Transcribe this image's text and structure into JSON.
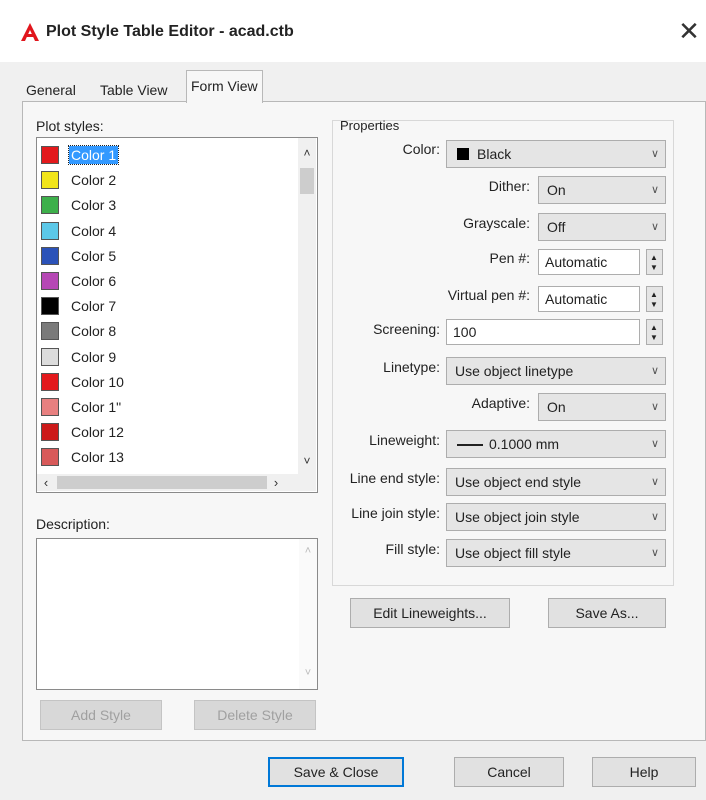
{
  "window": {
    "title": "Plot Style Table Editor - acad.ctb",
    "logo_letter": "A",
    "logo_color": "#e1161d",
    "close_glyph": "✕"
  },
  "tabs": [
    {
      "label": "General"
    },
    {
      "label": "Table View"
    },
    {
      "label": "Form View",
      "active": true
    }
  ],
  "plot_styles": {
    "label": "Plot styles:",
    "selected": "Color 1",
    "items": [
      {
        "label": "Color 1",
        "color": "#e3191c"
      },
      {
        "label": "Color 2",
        "color": "#f2e51a"
      },
      {
        "label": "Color 3",
        "color": "#3db04b"
      },
      {
        "label": "Color 4",
        "color": "#5cc8e8"
      },
      {
        "label": "Color 5",
        "color": "#2b52b8"
      },
      {
        "label": "Color 6",
        "color": "#b648b5"
      },
      {
        "label": "Color 7",
        "color": "#000000"
      },
      {
        "label": "Color 8",
        "color": "#7a7a7a"
      },
      {
        "label": "Color 9",
        "color": "#dcdcdc"
      },
      {
        "label": "Color 10",
        "color": "#e3191c"
      },
      {
        "label": "Color 1\"",
        "color": "#e88080"
      },
      {
        "label": "Color 12",
        "color": "#cc1a1a"
      },
      {
        "label": "Color 13",
        "color": "#d85a5a"
      }
    ]
  },
  "description": {
    "label": "Description:",
    "value": ""
  },
  "buttons_left": {
    "add_style": "Add Style",
    "delete_style": "Delete Style"
  },
  "properties": {
    "heading": "Properties",
    "color_label": "Color:",
    "color_value": "Black",
    "color_swatch": "#000000",
    "dither_label": "Dither:",
    "dither_value": "On",
    "grayscale_label": "Grayscale:",
    "grayscale_value": "Off",
    "pen_label": "Pen #:",
    "pen_value": "Automatic",
    "virtual_pen_label": "Virtual pen #:",
    "virtual_pen_value": "Automatic",
    "screening_label": "Screening:",
    "screening_value": "100",
    "linetype_label": "Linetype:",
    "linetype_value": "Use object linetype",
    "adaptive_label": "Adaptive:",
    "adaptive_value": "On",
    "lineweight_label": "Lineweight:",
    "lineweight_value": "0.1000 mm",
    "line_end_label": "Line end style:",
    "line_end_value": "Use object end style",
    "line_join_label": "Line join style:",
    "line_join_value": "Use object join style",
    "fill_label": "Fill style:",
    "fill_value": "Use object fill style"
  },
  "buttons_right": {
    "edit_lineweights": "Edit Lineweights...",
    "save_as": "Save As..."
  },
  "footer": {
    "save_close": "Save & Close",
    "cancel": "Cancel",
    "help": "Help"
  },
  "icons": {
    "dropdown": "chevron-down-icon",
    "spinner": "spinner-icon",
    "scroll_up": "arrow-up-icon",
    "scroll_down": "arrow-down-icon",
    "scroll_left": "arrow-left-icon",
    "scroll_right": "arrow-right-icon"
  }
}
